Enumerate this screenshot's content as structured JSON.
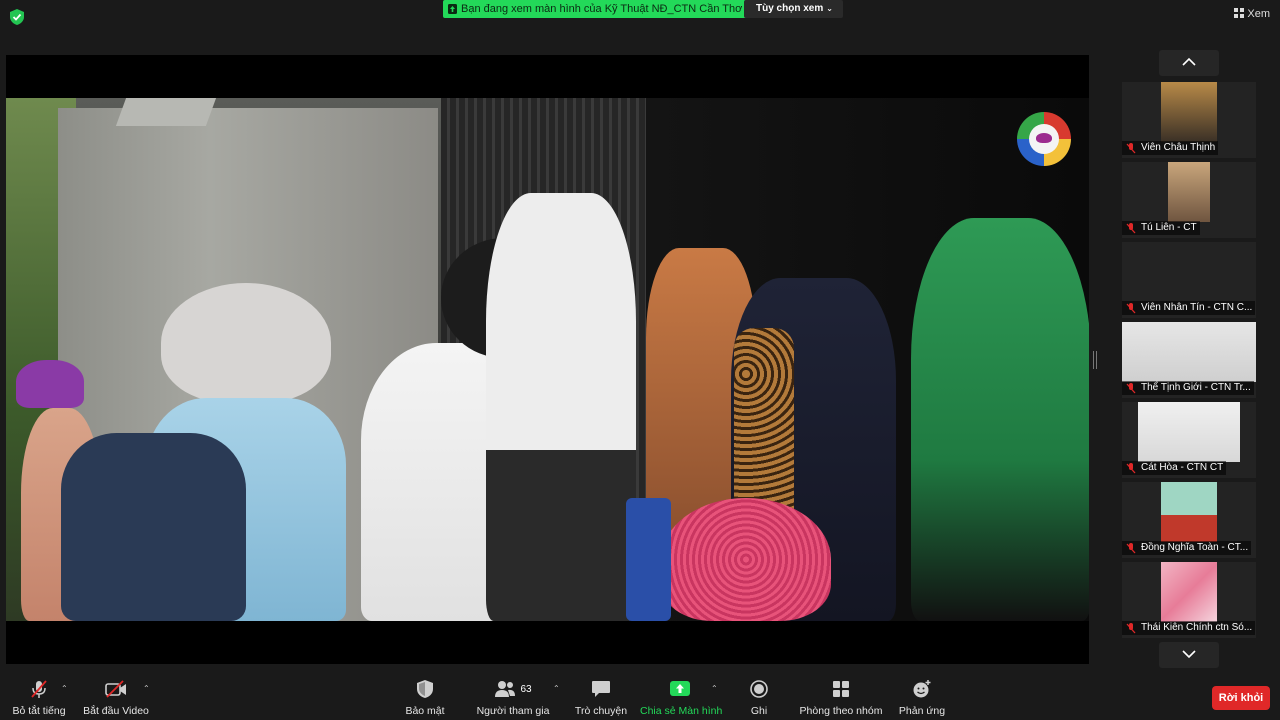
{
  "topbar": {
    "security_icon": "shield-check-icon",
    "share_banner": "Bạn đang xem màn hình của Kỹ Thuật NĐ_CTN Cần Thơ",
    "view_options": "Tùy chọn xem",
    "view_label": "Xem"
  },
  "colors": {
    "share_green": "#23d959",
    "leave_red": "#e02828",
    "background": "#1a1a1a",
    "muted_mic": "#e02828"
  },
  "participants": [
    {
      "name": "Viên Châu Thịnh",
      "mic": "muted-mic-icon"
    },
    {
      "name": "Tú Liên - CT",
      "mic": "muted-mic-icon"
    },
    {
      "name": "Viên Nhân Tín - CTN C...",
      "mic": "muted-mic-icon"
    },
    {
      "name": "Thể Tịnh Giới - CTN Tr...",
      "mic": "muted-mic-icon"
    },
    {
      "name": "Cát Hòa - CTN CT",
      "mic": "muted-mic-icon"
    },
    {
      "name": "Đồng Nghĩa Toàn - CT...",
      "mic": "muted-mic-icon"
    },
    {
      "name": "Thái Kiên Chính ctn Só...",
      "mic": "muted-mic-icon"
    }
  ],
  "toolbar": {
    "mute": "Bỏ tắt tiếng",
    "video": "Bắt đầu Video",
    "security": "Bảo mật",
    "participants": "Người tham gia",
    "participants_count": "63",
    "chat": "Trò chuyện",
    "share": "Chia sẻ Màn hình",
    "record": "Ghi",
    "breakout": "Phòng theo nhóm",
    "reactions": "Phản ứng",
    "leave": "Rời khỏi"
  }
}
